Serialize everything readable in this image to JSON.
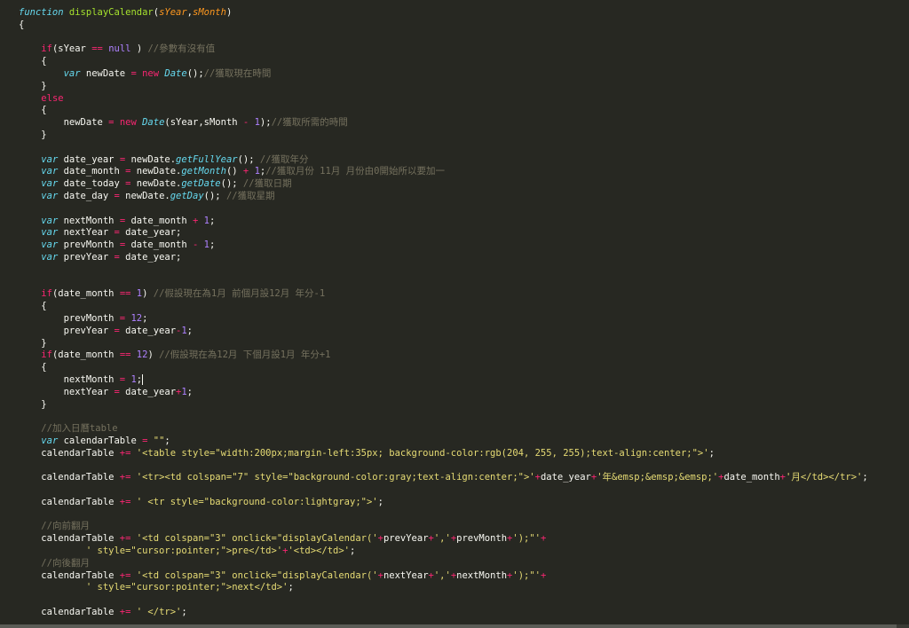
{
  "editor": {
    "caret_line": 31,
    "lines": [
      [
        {
          "t": "function",
          "c": "kw"
        },
        {
          "t": " "
        },
        {
          "t": "displayCalendar",
          "c": "fn"
        },
        {
          "t": "("
        },
        {
          "t": "sYear",
          "c": "param"
        },
        {
          "t": ","
        },
        {
          "t": "sMonth",
          "c": "param"
        },
        {
          "t": ")"
        }
      ],
      [
        {
          "t": "{"
        }
      ],
      [],
      [
        {
          "t": "    "
        },
        {
          "t": "if",
          "c": "ctl"
        },
        {
          "t": "(sYear "
        },
        {
          "t": "==",
          "c": "ctl"
        },
        {
          "t": " "
        },
        {
          "t": "null",
          "c": "num"
        },
        {
          "t": " ) "
        },
        {
          "t": "//參數有沒有值",
          "c": "cmt"
        }
      ],
      [
        {
          "t": "    {"
        }
      ],
      [
        {
          "t": "        "
        },
        {
          "t": "var",
          "c": "kw"
        },
        {
          "t": " newDate "
        },
        {
          "t": "=",
          "c": "ctl"
        },
        {
          "t": " "
        },
        {
          "t": "new",
          "c": "ctl"
        },
        {
          "t": " "
        },
        {
          "t": "Date",
          "c": "cls"
        },
        {
          "t": "();"
        },
        {
          "t": "//獲取現在時間",
          "c": "cmt"
        }
      ],
      [
        {
          "t": "    }"
        }
      ],
      [
        {
          "t": "    "
        },
        {
          "t": "else",
          "c": "ctl"
        }
      ],
      [
        {
          "t": "    {"
        }
      ],
      [
        {
          "t": "        newDate "
        },
        {
          "t": "=",
          "c": "ctl"
        },
        {
          "t": " "
        },
        {
          "t": "new",
          "c": "ctl"
        },
        {
          "t": " "
        },
        {
          "t": "Date",
          "c": "cls"
        },
        {
          "t": "(sYear,sMonth "
        },
        {
          "t": "-",
          "c": "ctl"
        },
        {
          "t": " "
        },
        {
          "t": "1",
          "c": "num"
        },
        {
          "t": ");"
        },
        {
          "t": "//獲取所需的時間",
          "c": "cmt"
        }
      ],
      [
        {
          "t": "    }"
        }
      ],
      [],
      [
        {
          "t": "    "
        },
        {
          "t": "var",
          "c": "kw"
        },
        {
          "t": " date_year "
        },
        {
          "t": "=",
          "c": "ctl"
        },
        {
          "t": " newDate."
        },
        {
          "t": "getFullYear",
          "c": "cls"
        },
        {
          "t": "(); "
        },
        {
          "t": "//獲取年分",
          "c": "cmt"
        }
      ],
      [
        {
          "t": "    "
        },
        {
          "t": "var",
          "c": "kw"
        },
        {
          "t": " date_month "
        },
        {
          "t": "=",
          "c": "ctl"
        },
        {
          "t": " newDate."
        },
        {
          "t": "getMonth",
          "c": "cls"
        },
        {
          "t": "() "
        },
        {
          "t": "+",
          "c": "ctl"
        },
        {
          "t": " "
        },
        {
          "t": "1",
          "c": "num"
        },
        {
          "t": ";"
        },
        {
          "t": "//獲取月份 11月 月份由0開始所以要加一",
          "c": "cmt"
        }
      ],
      [
        {
          "t": "    "
        },
        {
          "t": "var",
          "c": "kw"
        },
        {
          "t": " date_today "
        },
        {
          "t": "=",
          "c": "ctl"
        },
        {
          "t": " newDate."
        },
        {
          "t": "getDate",
          "c": "cls"
        },
        {
          "t": "(); "
        },
        {
          "t": "//獲取日期",
          "c": "cmt"
        }
      ],
      [
        {
          "t": "    "
        },
        {
          "t": "var",
          "c": "kw"
        },
        {
          "t": " date_day "
        },
        {
          "t": "=",
          "c": "ctl"
        },
        {
          "t": " newDate."
        },
        {
          "t": "getDay",
          "c": "cls"
        },
        {
          "t": "(); "
        },
        {
          "t": "//獲取星期",
          "c": "cmt"
        }
      ],
      [],
      [
        {
          "t": "    "
        },
        {
          "t": "var",
          "c": "kw"
        },
        {
          "t": " nextMonth "
        },
        {
          "t": "=",
          "c": "ctl"
        },
        {
          "t": " date_month "
        },
        {
          "t": "+",
          "c": "ctl"
        },
        {
          "t": " "
        },
        {
          "t": "1",
          "c": "num"
        },
        {
          "t": ";"
        }
      ],
      [
        {
          "t": "    "
        },
        {
          "t": "var",
          "c": "kw"
        },
        {
          "t": " nextYear "
        },
        {
          "t": "=",
          "c": "ctl"
        },
        {
          "t": " date_year;"
        }
      ],
      [
        {
          "t": "    "
        },
        {
          "t": "var",
          "c": "kw"
        },
        {
          "t": " prevMonth "
        },
        {
          "t": "=",
          "c": "ctl"
        },
        {
          "t": " date_month "
        },
        {
          "t": "-",
          "c": "ctl"
        },
        {
          "t": " "
        },
        {
          "t": "1",
          "c": "num"
        },
        {
          "t": ";"
        }
      ],
      [
        {
          "t": "    "
        },
        {
          "t": "var",
          "c": "kw"
        },
        {
          "t": " prevYear "
        },
        {
          "t": "=",
          "c": "ctl"
        },
        {
          "t": " date_year;"
        }
      ],
      [],
      [],
      [
        {
          "t": "    "
        },
        {
          "t": "if",
          "c": "ctl"
        },
        {
          "t": "(date_month "
        },
        {
          "t": "==",
          "c": "ctl"
        },
        {
          "t": " "
        },
        {
          "t": "1",
          "c": "num"
        },
        {
          "t": ") "
        },
        {
          "t": "//假設現在為1月 前個月設12月 年分-1",
          "c": "cmt"
        }
      ],
      [
        {
          "t": "    {"
        }
      ],
      [
        {
          "t": "        prevMonth "
        },
        {
          "t": "=",
          "c": "ctl"
        },
        {
          "t": " "
        },
        {
          "t": "12",
          "c": "num"
        },
        {
          "t": ";"
        }
      ],
      [
        {
          "t": "        prevYear "
        },
        {
          "t": "=",
          "c": "ctl"
        },
        {
          "t": " date_year"
        },
        {
          "t": "-",
          "c": "ctl"
        },
        {
          "t": "1",
          "c": "num"
        },
        {
          "t": ";"
        }
      ],
      [
        {
          "t": "    }"
        }
      ],
      [
        {
          "t": "    "
        },
        {
          "t": "if",
          "c": "ctl"
        },
        {
          "t": "(date_month "
        },
        {
          "t": "==",
          "c": "ctl"
        },
        {
          "t": " "
        },
        {
          "t": "12",
          "c": "num"
        },
        {
          "t": ") "
        },
        {
          "t": "//假設現在為12月 下個月設1月 年分+1",
          "c": "cmt"
        }
      ],
      [
        {
          "t": "    {"
        }
      ],
      [
        {
          "t": "        nextMonth "
        },
        {
          "t": "=",
          "c": "ctl"
        },
        {
          "t": " "
        },
        {
          "t": "1",
          "c": "num"
        },
        {
          "t": ";"
        },
        {
          "caret": true
        }
      ],
      [
        {
          "t": "        nextYear "
        },
        {
          "t": "=",
          "c": "ctl"
        },
        {
          "t": " date_year"
        },
        {
          "t": "+",
          "c": "ctl"
        },
        {
          "t": "1",
          "c": "num"
        },
        {
          "t": ";"
        }
      ],
      [
        {
          "t": "    }"
        }
      ],
      [],
      [
        {
          "t": "    "
        },
        {
          "t": "//加入日曆table",
          "c": "cmt"
        }
      ],
      [
        {
          "t": "    "
        },
        {
          "t": "var",
          "c": "kw"
        },
        {
          "t": " calendarTable "
        },
        {
          "t": "=",
          "c": "ctl"
        },
        {
          "t": " "
        },
        {
          "t": "\"\"",
          "c": "str"
        },
        {
          "t": ";"
        }
      ],
      [
        {
          "t": "    calendarTable "
        },
        {
          "t": "+=",
          "c": "ctl"
        },
        {
          "t": " "
        },
        {
          "t": "'<table style=\"width:200px;margin-left:35px; background-color:rgb(204, 255, 255);text-align:center;\">'",
          "c": "str"
        },
        {
          "t": ";"
        }
      ],
      [],
      [
        {
          "t": "    calendarTable "
        },
        {
          "t": "+=",
          "c": "ctl"
        },
        {
          "t": " "
        },
        {
          "t": "'<tr><td colspan=\"7\" style=\"background-color:gray;text-align:center;\">'",
          "c": "str"
        },
        {
          "t": "+",
          "c": "ctl"
        },
        {
          "t": "date_year"
        },
        {
          "t": "+",
          "c": "ctl"
        },
        {
          "t": "'年&emsp;&emsp;&emsp;'",
          "c": "str"
        },
        {
          "t": "+",
          "c": "ctl"
        },
        {
          "t": "date_month"
        },
        {
          "t": "+",
          "c": "ctl"
        },
        {
          "t": "'月</td></tr>'",
          "c": "str"
        },
        {
          "t": ";"
        }
      ],
      [],
      [
        {
          "t": "    calendarTable "
        },
        {
          "t": "+=",
          "c": "ctl"
        },
        {
          "t": " "
        },
        {
          "t": "' <tr style=\"background-color:lightgray;\">'",
          "c": "str"
        },
        {
          "t": ";"
        }
      ],
      [],
      [
        {
          "t": "    "
        },
        {
          "t": "//向前翻月",
          "c": "cmt"
        }
      ],
      [
        {
          "t": "    calendarTable "
        },
        {
          "t": "+=",
          "c": "ctl"
        },
        {
          "t": " "
        },
        {
          "t": "'<td colspan=\"3\" onclick=\"displayCalendar('",
          "c": "str"
        },
        {
          "t": "+",
          "c": "ctl"
        },
        {
          "t": "prevYear"
        },
        {
          "t": "+",
          "c": "ctl"
        },
        {
          "t": "','",
          "c": "str"
        },
        {
          "t": "+",
          "c": "ctl"
        },
        {
          "t": "prevMonth"
        },
        {
          "t": "+",
          "c": "ctl"
        },
        {
          "t": "');\"'",
          "c": "str"
        },
        {
          "t": "+",
          "c": "ctl"
        }
      ],
      [
        {
          "t": "            "
        },
        {
          "t": "' style=\"cursor:pointer;\">pre</td>'",
          "c": "str"
        },
        {
          "t": "+",
          "c": "ctl"
        },
        {
          "t": "'<td></td>'",
          "c": "str"
        },
        {
          "t": ";"
        }
      ],
      [
        {
          "t": "    "
        },
        {
          "t": "//向後翻月",
          "c": "cmt"
        }
      ],
      [
        {
          "t": "    calendarTable "
        },
        {
          "t": "+=",
          "c": "ctl"
        },
        {
          "t": " "
        },
        {
          "t": "'<td colspan=\"3\" onclick=\"displayCalendar('",
          "c": "str"
        },
        {
          "t": "+",
          "c": "ctl"
        },
        {
          "t": "nextYear"
        },
        {
          "t": "+",
          "c": "ctl"
        },
        {
          "t": "','",
          "c": "str"
        },
        {
          "t": "+",
          "c": "ctl"
        },
        {
          "t": "nextMonth"
        },
        {
          "t": "+",
          "c": "ctl"
        },
        {
          "t": "');\"'",
          "c": "str"
        },
        {
          "t": "+",
          "c": "ctl"
        }
      ],
      [
        {
          "t": "            "
        },
        {
          "t": "' style=\"cursor:pointer;\">next</td>'",
          "c": "str"
        },
        {
          "t": ";"
        }
      ],
      [],
      [
        {
          "t": "    calendarTable "
        },
        {
          "t": "+=",
          "c": "ctl"
        },
        {
          "t": " "
        },
        {
          "t": "' </tr>'",
          "c": "str"
        },
        {
          "t": ";"
        }
      ]
    ]
  },
  "theme": {
    "background": "#272822",
    "text": "#f8f8f2",
    "keyword": "#66d9ef",
    "control": "#f92672",
    "number": "#ae81ff",
    "string": "#e6db74",
    "comment": "#75715e",
    "function": "#a6e22e",
    "parameter": "#fd971f"
  }
}
